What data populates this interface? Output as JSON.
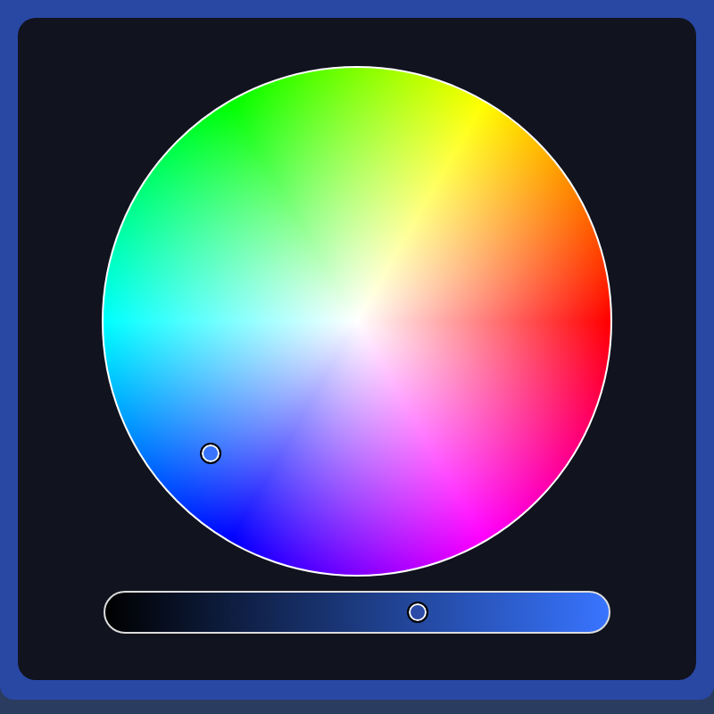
{
  "color_wheel": {
    "color": "#3874ff"
  },
  "brightness_slider": {
    "level": 0.63
  }
}
